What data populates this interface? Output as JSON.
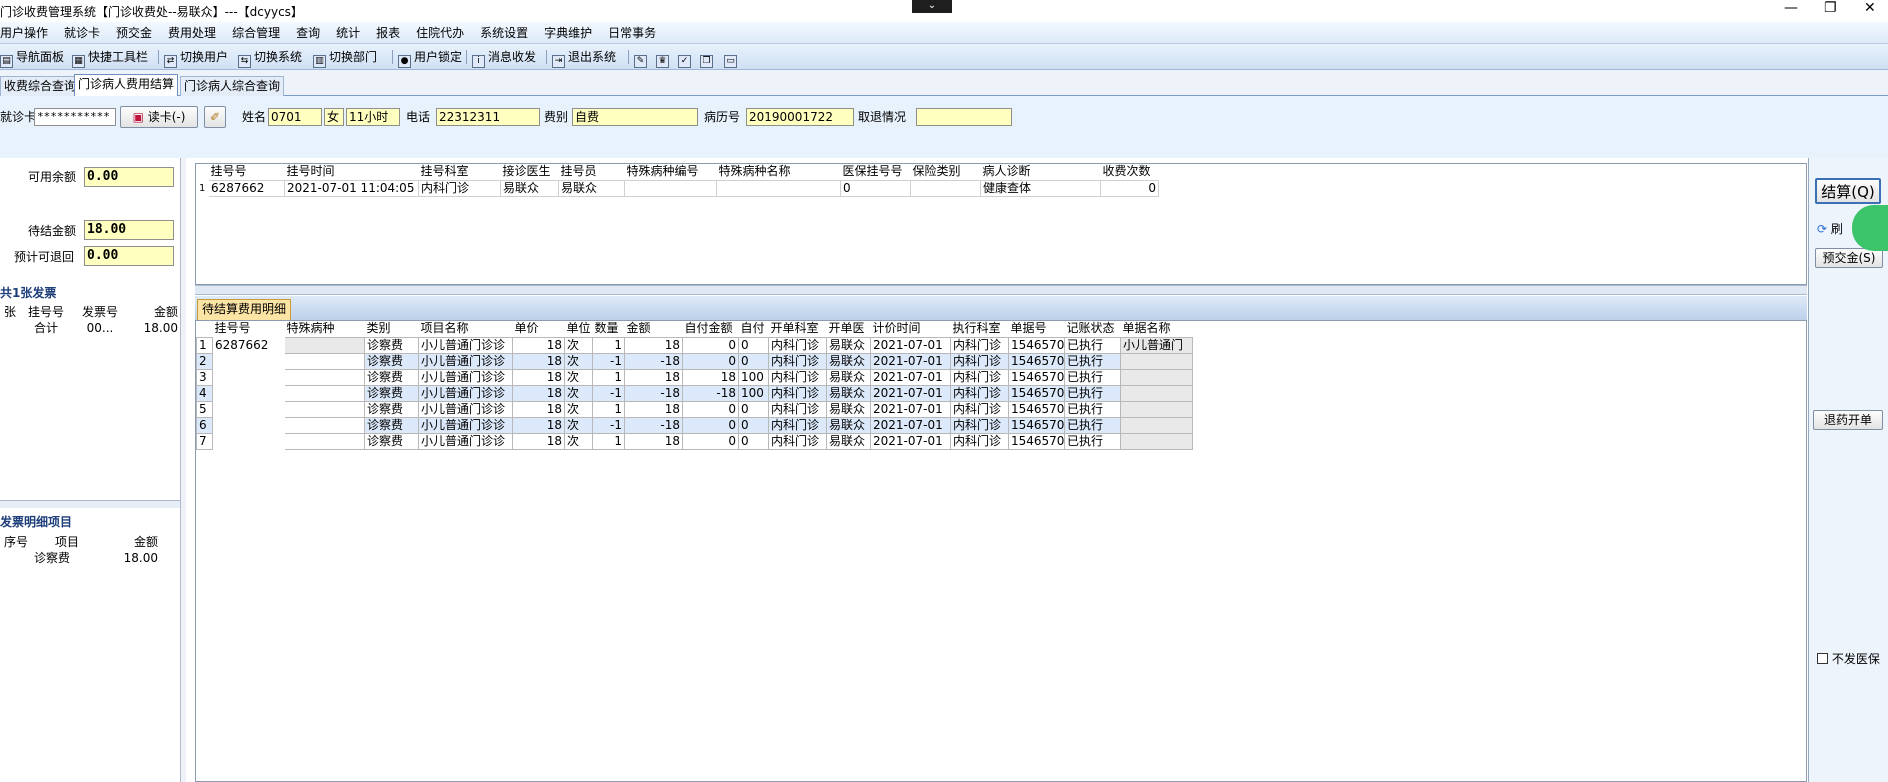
{
  "window": {
    "title": "门诊收费管理系统【门诊收费处--易联众】---【dcyycs】",
    "dropdown_glyph": "⌄",
    "minimize": "—",
    "restore": "❐",
    "close": "✕"
  },
  "menu": [
    "用户操作",
    "就诊卡",
    "预交金",
    "费用处理",
    "综合管理",
    "查询",
    "统计",
    "报表",
    "住院代办",
    "系统设置",
    "字典维护",
    "日常事务"
  ],
  "toolbar": {
    "nav_panel": "导航面板",
    "quick_toolbar": "快捷工具栏",
    "switch_user": "切换用户",
    "switch_system": "切换系统",
    "switch_dept": "切换部门",
    "lock_user": "用户锁定",
    "messages": "消息收发",
    "exit": "退出系统"
  },
  "tabs": [
    "收费综合查询",
    "门诊病人费用结算",
    "门诊病人综合查询"
  ],
  "patient": {
    "card_label": "就诊卡",
    "card_value": "***********",
    "read_card": "读卡(-)",
    "name_label": "姓名",
    "name_value": "0701",
    "sex_value": "女",
    "age_value": "11小时",
    "phone_label": "电话",
    "phone_value": "22312311",
    "fee_type_label": "费别",
    "fee_type_value": "自费",
    "record_label": "病历号",
    "record_value": "20190001722",
    "refund_label": "取退情况",
    "refund_value": ""
  },
  "balance": {
    "available_label": "可用余额",
    "available_value": "0.00",
    "pending_label": "待结金额",
    "pending_value": "18.00",
    "refund_label": "预计可退回",
    "refund_value": "0.00"
  },
  "invoice": {
    "title": "共1张发票",
    "headers": [
      "张",
      "挂号号",
      "发票号",
      "金额"
    ],
    "row": [
      "合计",
      "00...",
      "18.00"
    ]
  },
  "invoice_detail": {
    "title": "发票明细项目",
    "headers": [
      "序号",
      "项目",
      "金额"
    ],
    "row": [
      "诊察费",
      "18.00"
    ]
  },
  "registration": {
    "headers": [
      "挂号号",
      "挂号时间",
      "挂号科室",
      "接诊医生",
      "挂号员",
      "特殊病种编号",
      "特殊病种名称",
      "医保挂号号",
      "保险类别",
      "病人诊断",
      "收费次数"
    ],
    "rows": [
      {
        "idx": "1",
        "reg_no": "6287662",
        "time": "2021-07-01 11:04:05",
        "dept": "内科门诊",
        "doctor": "易联众",
        "clerk": "易联众",
        "sp_code": "",
        "sp_name": "",
        "ins_reg": "0",
        "ins_type": "",
        "diagnosis": "健康查体",
        "count": "0"
      }
    ]
  },
  "detail": {
    "tab": "待结算费用明细",
    "headers": [
      "挂号号",
      "特殊病种",
      "类别",
      "项目名称",
      "单价",
      "单位",
      "数量",
      "金额",
      "自付金额",
      "自付",
      "开单科室",
      "开单医",
      "计价时间",
      "执行科室",
      "单据号",
      "记账状态",
      "单据名称"
    ],
    "reg_no": "6287662",
    "doc_name": "小儿普通门",
    "rows": [
      {
        "idx": "1",
        "cat": "诊察费",
        "item": "小儿普通门诊诊",
        "price": "18",
        "unit": "次",
        "qty": "1",
        "amount": "18",
        "self_amt": "0",
        "self": "0",
        "dept": "内科门诊",
        "doctor": "易联众",
        "time": "2021-07-01",
        "exec": "内科门诊",
        "bill": "1546570",
        "status": "已执行"
      },
      {
        "idx": "2",
        "cat": "诊察费",
        "item": "小儿普通门诊诊",
        "price": "18",
        "unit": "次",
        "qty": "-1",
        "amount": "-18",
        "self_amt": "0",
        "self": "0",
        "dept": "内科门诊",
        "doctor": "易联众",
        "time": "2021-07-01",
        "exec": "内科门诊",
        "bill": "1546570",
        "status": "已执行"
      },
      {
        "idx": "3",
        "cat": "诊察费",
        "item": "小儿普通门诊诊",
        "price": "18",
        "unit": "次",
        "qty": "1",
        "amount": "18",
        "self_amt": "18",
        "self": "100",
        "dept": "内科门诊",
        "doctor": "易联众",
        "time": "2021-07-01",
        "exec": "内科门诊",
        "bill": "1546570",
        "status": "已执行"
      },
      {
        "idx": "4",
        "cat": "诊察费",
        "item": "小儿普通门诊诊",
        "price": "18",
        "unit": "次",
        "qty": "-1",
        "amount": "-18",
        "self_amt": "-18",
        "self": "100",
        "dept": "内科门诊",
        "doctor": "易联众",
        "time": "2021-07-01",
        "exec": "内科门诊",
        "bill": "1546570",
        "status": "已执行"
      },
      {
        "idx": "5",
        "cat": "诊察费",
        "item": "小儿普通门诊诊",
        "price": "18",
        "unit": "次",
        "qty": "1",
        "amount": "18",
        "self_amt": "0",
        "self": "0",
        "dept": "内科门诊",
        "doctor": "易联众",
        "time": "2021-07-01",
        "exec": "内科门诊",
        "bill": "1546570",
        "status": "已执行"
      },
      {
        "idx": "6",
        "cat": "诊察费",
        "item": "小儿普通门诊诊",
        "price": "18",
        "unit": "次",
        "qty": "-1",
        "amount": "-18",
        "self_amt": "0",
        "self": "0",
        "dept": "内科门诊",
        "doctor": "易联众",
        "time": "2021-07-01",
        "exec": "内科门诊",
        "bill": "1546570",
        "status": "已执行"
      },
      {
        "idx": "7",
        "cat": "诊察费",
        "item": "小儿普通门诊诊",
        "price": "18",
        "unit": "次",
        "qty": "1",
        "amount": "18",
        "self_amt": "0",
        "self": "0",
        "dept": "内科门诊",
        "doctor": "易联众",
        "time": "2021-07-01",
        "exec": "内科门诊",
        "bill": "1546570",
        "status": "已执行"
      }
    ]
  },
  "right": {
    "settle": "结算(Q)",
    "refresh": "刷",
    "prepay": "预交金(S)",
    "drug_refund": "退药开单",
    "no_invoice": "不发医保"
  }
}
